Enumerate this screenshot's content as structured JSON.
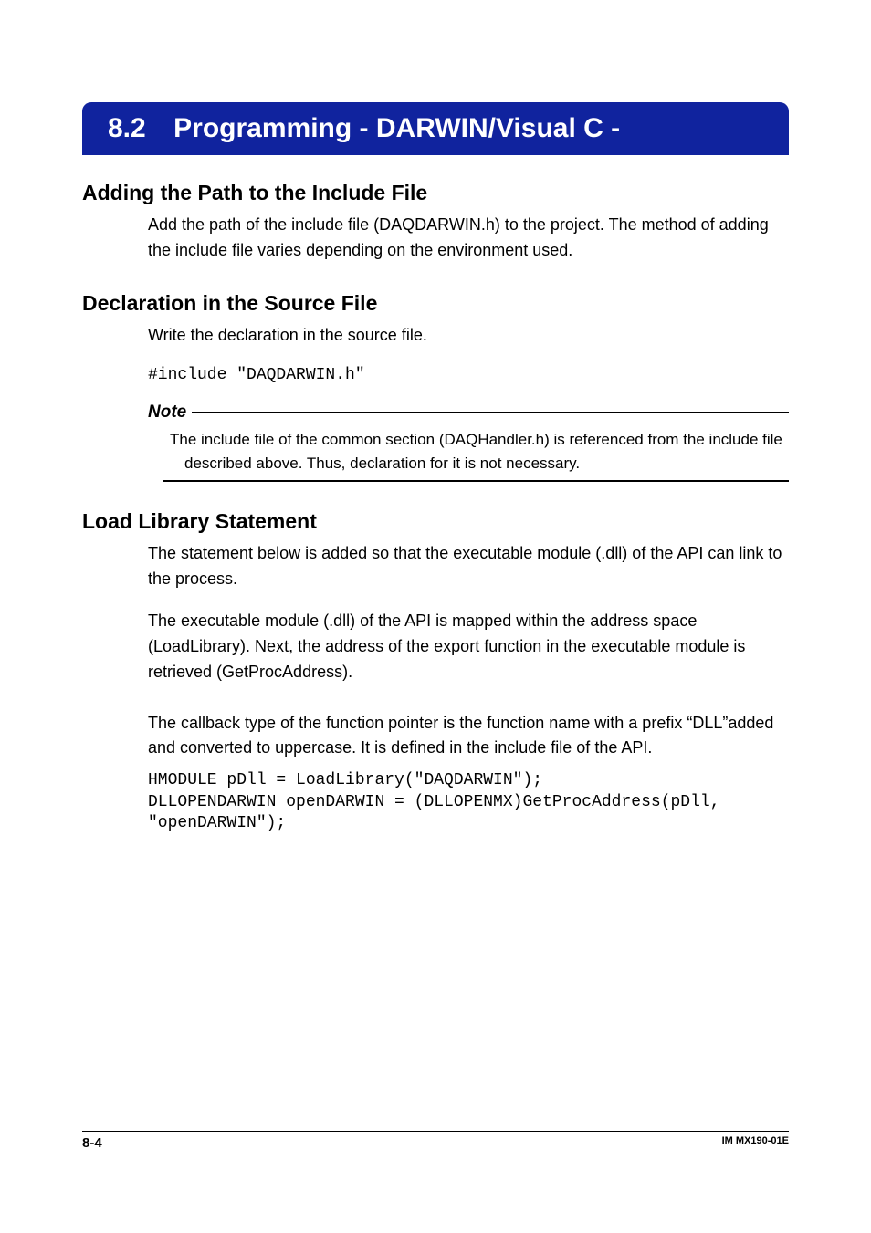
{
  "header": {
    "number": "8.2",
    "title": "Programming - DARWIN/Visual C -"
  },
  "sections": {
    "adding_path": {
      "title": "Adding the Path to the Include File",
      "body": "Add the path of the include file (DAQDARWIN.h) to the project. The method of adding the include file varies depending on the environment used."
    },
    "declaration": {
      "title": "Declaration in the Source File",
      "body": "Write the declaration in the source file.",
      "code": "#include \"DAQDARWIN.h\"",
      "note_label": "Note",
      "note_body": "The include file of the common section (DAQHandler.h) is referenced from the include file described above. Thus, declaration for it is not necessary."
    },
    "load_library": {
      "title": "Load Library Statement",
      "body1": "The statement below is added so that the executable module (.dll) of the API can link to the process.",
      "body2": "The executable module (.dll) of the API is mapped within the address space (LoadLibrary). Next, the address of the export function in the executable module is retrieved (GetProcAddress).",
      "body3": "The callback type of the function pointer is the function name with a prefix “DLL”added and converted to uppercase. It is defined in the include file of the API.",
      "code": "HMODULE pDll = LoadLibrary(\"DAQDARWIN\");\nDLLOPENDARWIN openDARWIN = (DLLOPENMX)GetProcAddress(pDll,\n\"openDARWIN\");"
    }
  },
  "footer": {
    "page": "8-4",
    "doc_id": "IM MX190-01E"
  }
}
